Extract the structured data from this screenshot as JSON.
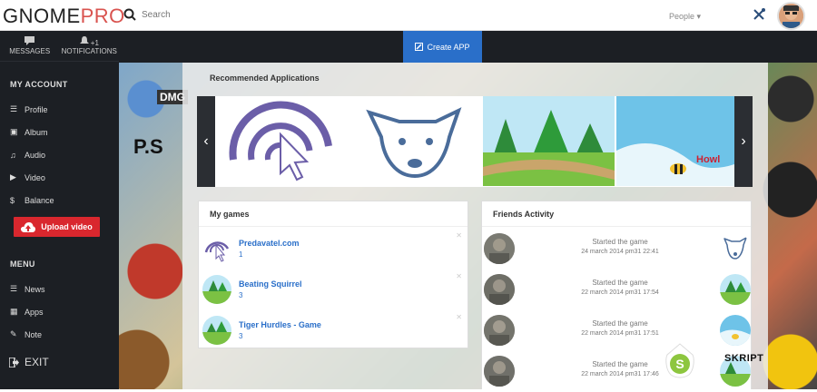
{
  "header": {
    "logo_part1": "GNOME",
    "logo_part2": "PRO",
    "search_placeholder": "Search",
    "people_label": "People",
    "icons": {
      "search": "search-icon",
      "tools": "tools-icon",
      "avatar": "user-avatar"
    }
  },
  "sidebar": {
    "top": [
      {
        "label": "MESSAGES",
        "icon": "chat-icon"
      },
      {
        "label": "NOTIFICATIONS",
        "icon": "bell-icon",
        "badge": "+1"
      }
    ],
    "my_account_title": "MY ACCOUNT",
    "account_items": [
      {
        "label": "Profile",
        "icon": "list-icon"
      },
      {
        "label": "Album",
        "icon": "image-icon"
      },
      {
        "label": "Audio",
        "icon": "music-icon"
      },
      {
        "label": "Video",
        "icon": "video-icon"
      },
      {
        "label": "Balance",
        "icon": "dollar-icon"
      }
    ],
    "upload_label": "Upload video",
    "menu_title": "MENU",
    "menu_items": [
      {
        "label": "News",
        "icon": "list-icon"
      },
      {
        "label": "Apps",
        "icon": "grid-icon"
      },
      {
        "label": "Note",
        "icon": "pencil-icon"
      }
    ],
    "exit_label": "EXIT"
  },
  "toolbar": {
    "create_app_label": "Create APP"
  },
  "recommended": {
    "title": "Recommended Applications",
    "items": [
      "viber-app",
      "vk-dog-app",
      "jungle-game",
      "bee-game"
    ],
    "item_text": "Howl"
  },
  "my_games": {
    "title": "My games",
    "items": [
      {
        "name": "Predavatel.com",
        "count": "1"
      },
      {
        "name": "Beating Squirrel",
        "count": "3"
      },
      {
        "name": "Tiger Hurdles - Game",
        "count": "3"
      }
    ]
  },
  "friends_activity": {
    "title": "Friends Activity",
    "items": [
      {
        "action": "Started the game",
        "time": "24 march 2014 pm31 22:41"
      },
      {
        "action": "Started the game",
        "time": "22 march 2014 pm31 17:54"
      },
      {
        "action": "Started the game",
        "time": "22 march 2014 pm31 17:51"
      },
      {
        "action": "Started the game",
        "time": "22 march 2014 pm31 17:46"
      }
    ]
  },
  "watermark": {
    "text": "SKRIPT",
    "badge_letter": "S"
  },
  "background_text": {
    "dmg": "DMG",
    "ps": "P.S"
  },
  "colors": {
    "accent": "#2a6fc9",
    "upload": "#d9272e",
    "logo_pro": "#d9534f",
    "dark": "#1c1f24"
  }
}
